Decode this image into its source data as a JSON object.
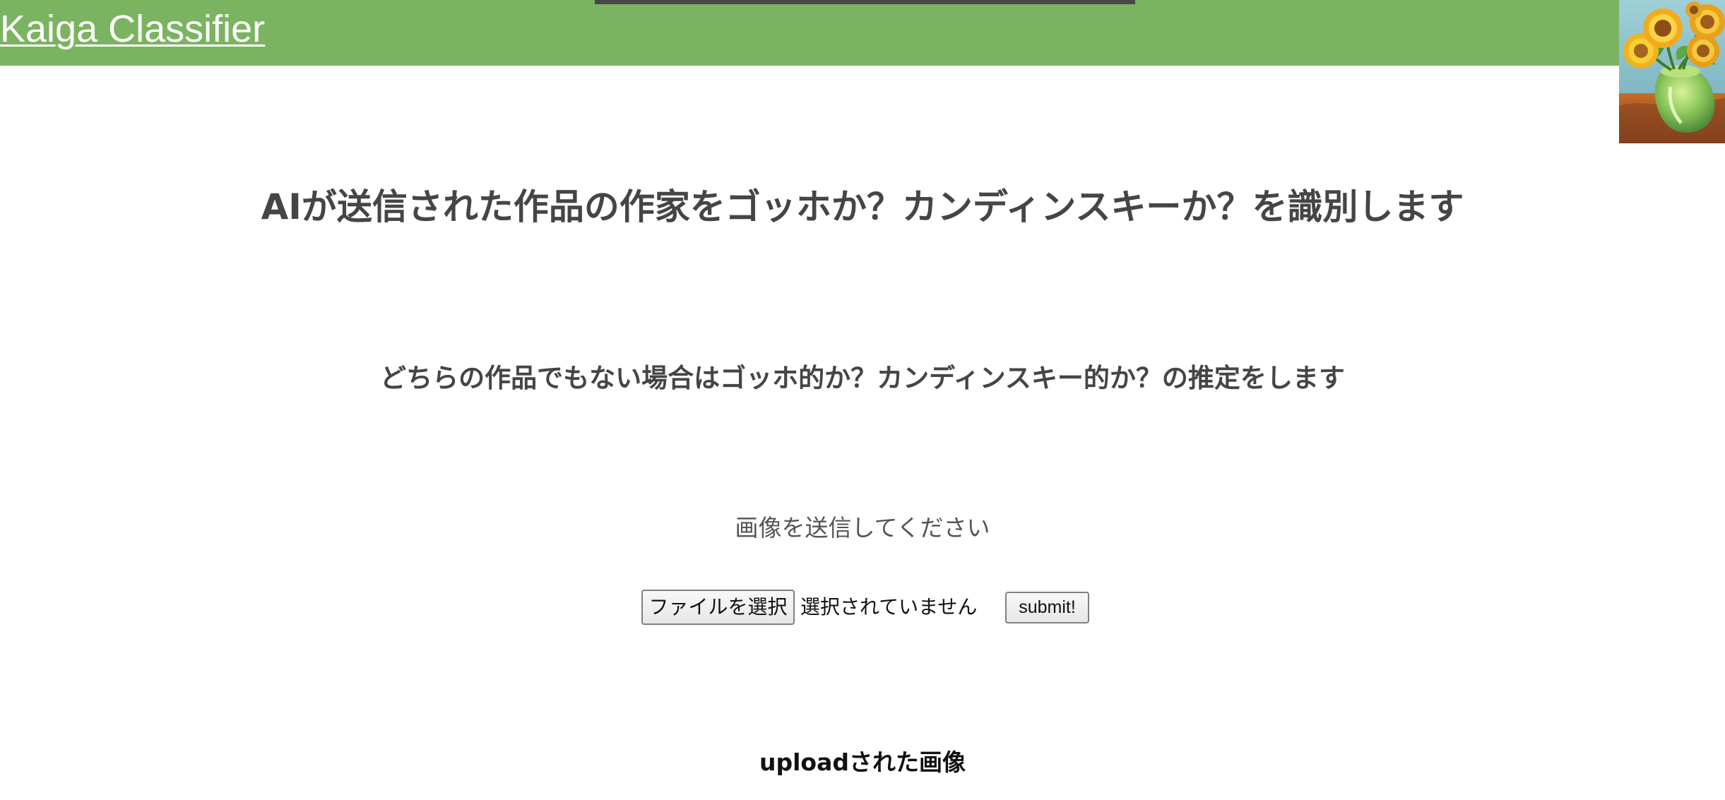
{
  "header": {
    "title": "Kaiga Classifier",
    "background_color": "#7bb461",
    "logo_icon": "sunflowers-painting-icon"
  },
  "main": {
    "heading": "AIが送信された作品の作家をゴッホか？カンディンスキーか？を識別します",
    "subheading": "どちらの作品でもない場合はゴッホ的か？カンディンスキー的か？の推定をします",
    "prompt": "画像を送信してください"
  },
  "upload": {
    "file_button_label": "ファイルを選択",
    "file_status": "選択されていません",
    "submit_label": "submit!"
  },
  "result": {
    "uploaded_label": "uploadされた画像"
  }
}
